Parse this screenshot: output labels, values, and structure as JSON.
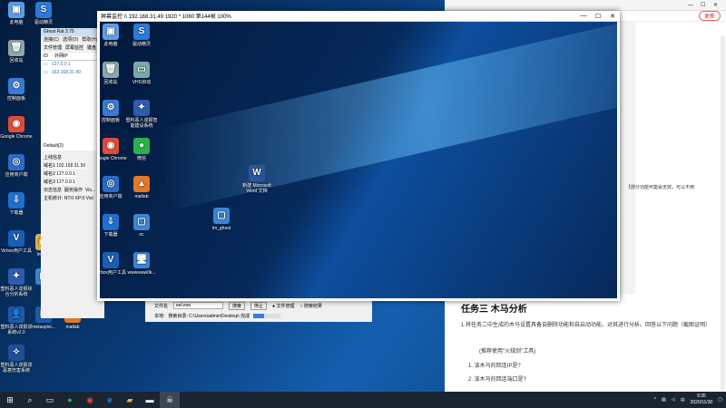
{
  "desktop_icons": [
    {
      "label": "此电脑",
      "glyph": "▣",
      "color": "#5aa0e6"
    },
    {
      "label": "回收站",
      "glyph": "🗑",
      "color": "#8aa"
    },
    {
      "label": "控制面板",
      "glyph": "⚙",
      "color": "#3a7bd5"
    },
    {
      "label": "Google Chrome",
      "glyph": "◉",
      "color": "#e04b3a"
    },
    {
      "label": "应用商户端",
      "glyph": "◎",
      "color": "#2a6cc8"
    },
    {
      "label": "下载器",
      "glyph": "⇩",
      "color": "#1f6fd1"
    },
    {
      "label": "Virbox用户工具",
      "glyph": "V",
      "color": "#1a5fb5"
    },
    {
      "label": "塑料恶人谍报综合分析系统",
      "glyph": "✦",
      "color": "#2b5dad"
    },
    {
      "label": "塑料恶人谍报谍系统v2.0",
      "glyph": "👤",
      "color": "#2457a8"
    },
    {
      "label": "塑料恶人谍报谍恶意伤害系统",
      "glyph": "✧",
      "color": "#1e4f98"
    }
  ],
  "desktop_icons_col2": [
    {
      "label": "驱动精灵",
      "glyph": "S",
      "color": "#2c7ad6"
    },
    {
      "label": "lnword",
      "glyph": "📁",
      "color": "#e0b050"
    },
    {
      "label": "lcx",
      "glyph": "▢",
      "color": "#3a86d8"
    },
    {
      "label": "metasploi...",
      "glyph": "M",
      "color": "#1e5aa8"
    },
    {
      "label": "matlab",
      "glyph": "▲",
      "color": "#e07a2a"
    }
  ],
  "rat_window": {
    "title": "Ghost Rat 3.75",
    "menu": [
      "连接(C)",
      "选项(O)",
      "帮助(H)"
    ],
    "toolbar": [
      "文件管理",
      "屏幕监控",
      "键盘"
    ],
    "columns": [
      "ID",
      "外网IP"
    ],
    "hosts": [
      {
        "id": "",
        "ip": "127.0.0.1"
      },
      {
        "id": "",
        "ip": "192.168.31.49"
      }
    ],
    "group_tab": "Default(2)",
    "fields": [
      {
        "label": "上线信息",
        "value": ""
      },
      {
        "label": "域名1",
        "value": "192.168.31.50"
      },
      {
        "label": "域名2",
        "value": "127.0.0.1"
      },
      {
        "label": "域名3",
        "value": "127.0.0.1"
      }
    ],
    "status_tabs": [
      "日志信息",
      "服务操作",
      "Vis..."
    ],
    "status_line": "主机统计: NT:0 XP:0 Vist"
  },
  "remote_window": {
    "title": "屏幕监控 \\\\ 192.168.31.49 1920 * 1080 第144帧 100%"
  },
  "remote_icons": [
    {
      "label": "此电脑",
      "glyph": "▣",
      "color": "#5aa0e6"
    },
    {
      "label": "回收站",
      "glyph": "🗑",
      "color": "#8aa"
    },
    {
      "label": "控制面板",
      "glyph": "⚙",
      "color": "#3a7bd5"
    },
    {
      "label": "Google Chrome",
      "glyph": "◉",
      "color": "#e04b3a"
    },
    {
      "label": "应用商户端",
      "glyph": "◎",
      "color": "#2a6cc8"
    },
    {
      "label": "下载器",
      "glyph": "⇩",
      "color": "#1f6fd1"
    },
    {
      "label": "Virbox用户工具",
      "glyph": "V",
      "color": "#1a5fb5"
    }
  ],
  "remote_icons_col2": [
    {
      "label": "驱动精灵",
      "glyph": "S",
      "color": "#2c7ad6"
    },
    {
      "label": "VHD启动",
      "glyph": "▭",
      "color": "#7aa"
    },
    {
      "label": "塑料恶人谍报智能建设系统",
      "glyph": "✦",
      "color": "#2b5dad"
    },
    {
      "label": "微信",
      "glyph": "●",
      "color": "#2ab24a"
    },
    {
      "label": "matlab",
      "glyph": "▲",
      "color": "#e07a2a"
    },
    {
      "label": "nc",
      "glyph": "▢",
      "color": "#3a86d8"
    },
    {
      "label": "wwwwww0k...",
      "glyph": "🖥",
      "color": "#3a86d8"
    }
  ],
  "remote_extra": [
    {
      "label": "im_ghost",
      "glyph": "▢",
      "color": "#3a86d8"
    },
    {
      "label": "新建 Microsoft Word 文档",
      "glyph": "W",
      "color": "#2b579a"
    }
  ],
  "file_bar": {
    "label": "文件名",
    "value": "eel.exe",
    "browse": "搜索",
    "stop": "停止",
    "manage": "文件管理",
    "result": "搜索结果",
    "local_label": "本地:",
    "path": "搜索目录: C:\\Users\\admin\\Desktop\\ 完成"
  },
  "document": {
    "tab": "html",
    "side_note": "【部分功能可能会无效，可以不用",
    "heading": "任务三 木马分析",
    "para1": "1.将任务二中生成的木马设置具备自删除功能和自启动功能，对其进行分析。回答以下问题（截图证明）",
    "hint": "(推荐使用\"火绒剑\"工具)",
    "q1": "1. 该木马的回连IP是?",
    "q2": "2. 该木马的回连端口是?",
    "update": "更新"
  },
  "clock": {
    "time": "9:35",
    "date": "2020/11/30"
  }
}
